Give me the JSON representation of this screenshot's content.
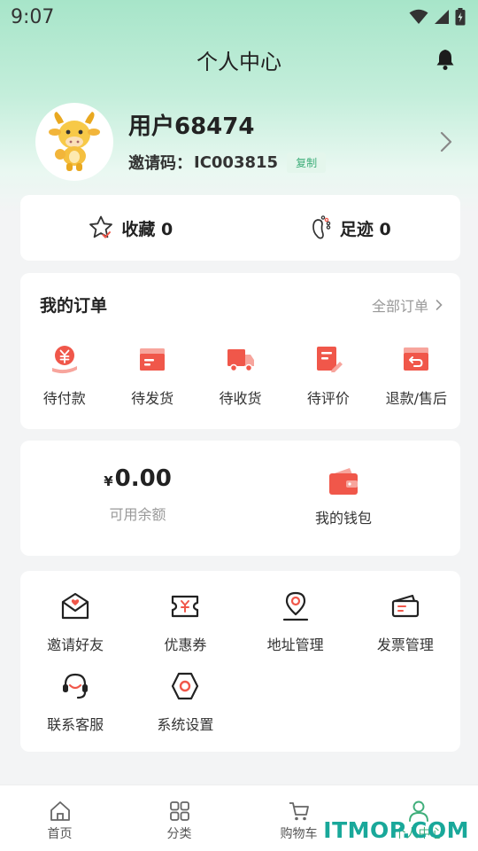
{
  "status_bar": {
    "time": "9:07"
  },
  "header": {
    "title": "个人中心"
  },
  "profile": {
    "username": "用户68474",
    "invite_label": "邀请码：",
    "invite_code": "IC003815",
    "copy_label": "复制"
  },
  "favorites": {
    "collect_label": "收藏 0",
    "footprint_label": "足迹 0"
  },
  "orders": {
    "title": "我的订单",
    "all_label": "全部订单",
    "items": [
      {
        "label": "待付款",
        "icon": "payment-icon"
      },
      {
        "label": "待发货",
        "icon": "box-icon"
      },
      {
        "label": "待收货",
        "icon": "truck-icon"
      },
      {
        "label": "待评价",
        "icon": "review-icon"
      },
      {
        "label": "退款/售后",
        "icon": "refund-icon"
      }
    ]
  },
  "wallet": {
    "currency": "¥",
    "balance": "0.00",
    "balance_label": "可用余额",
    "wallet_label": "我的钱包"
  },
  "tools": [
    {
      "label": "邀请好友",
      "icon": "invite-icon"
    },
    {
      "label": "优惠券",
      "icon": "coupon-icon"
    },
    {
      "label": "地址管理",
      "icon": "location-icon"
    },
    {
      "label": "发票管理",
      "icon": "invoice-icon"
    },
    {
      "label": "联系客服",
      "icon": "headset-icon"
    },
    {
      "label": "系统设置",
      "icon": "settings-icon"
    }
  ],
  "tabbar": [
    {
      "label": "首页",
      "icon": "home-icon"
    },
    {
      "label": "分类",
      "icon": "grid-icon"
    },
    {
      "label": "购物车",
      "icon": "cart-icon"
    },
    {
      "label": "个人中心",
      "icon": "user-icon",
      "active": true
    }
  ],
  "watermark": "ITMOP.COM",
  "colors": {
    "accent": "#3fae7a",
    "order_red": "#f0574a",
    "hero_green": "#a7e5c9"
  }
}
